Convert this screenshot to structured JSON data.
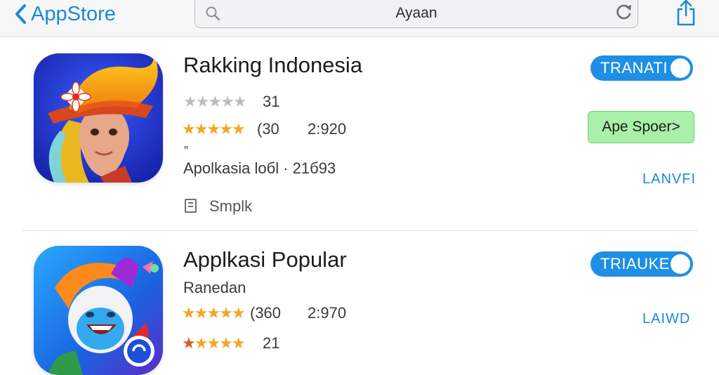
{
  "nav": {
    "back_label": "AppStore"
  },
  "search": {
    "value": "Ayaan"
  },
  "apps": [
    {
      "title": "Rakking Indonesia",
      "rating_count": "31",
      "rating_count2": "(30",
      "value2": "2:920",
      "mark": "„",
      "category_line": "Apolkasia loбl · 21б93",
      "sample_label": "Smplk",
      "toggle_label": "TRANATI",
      "store_button": "Ape Spoer>",
      "link_label": "LANVFI"
    },
    {
      "title": "Applkasi Popular",
      "subtitle": "Ranedan",
      "rating_count": "(360",
      "value2": "2:970",
      "rating_count2": "21",
      "toggle_label": "TRIAUKE",
      "link_label": "LAIWD"
    }
  ],
  "colors": {
    "accent": "#1a8ad8",
    "toggle": "#1e8fe4",
    "store_green": "#a9f0a8",
    "star": "#f5a623"
  }
}
